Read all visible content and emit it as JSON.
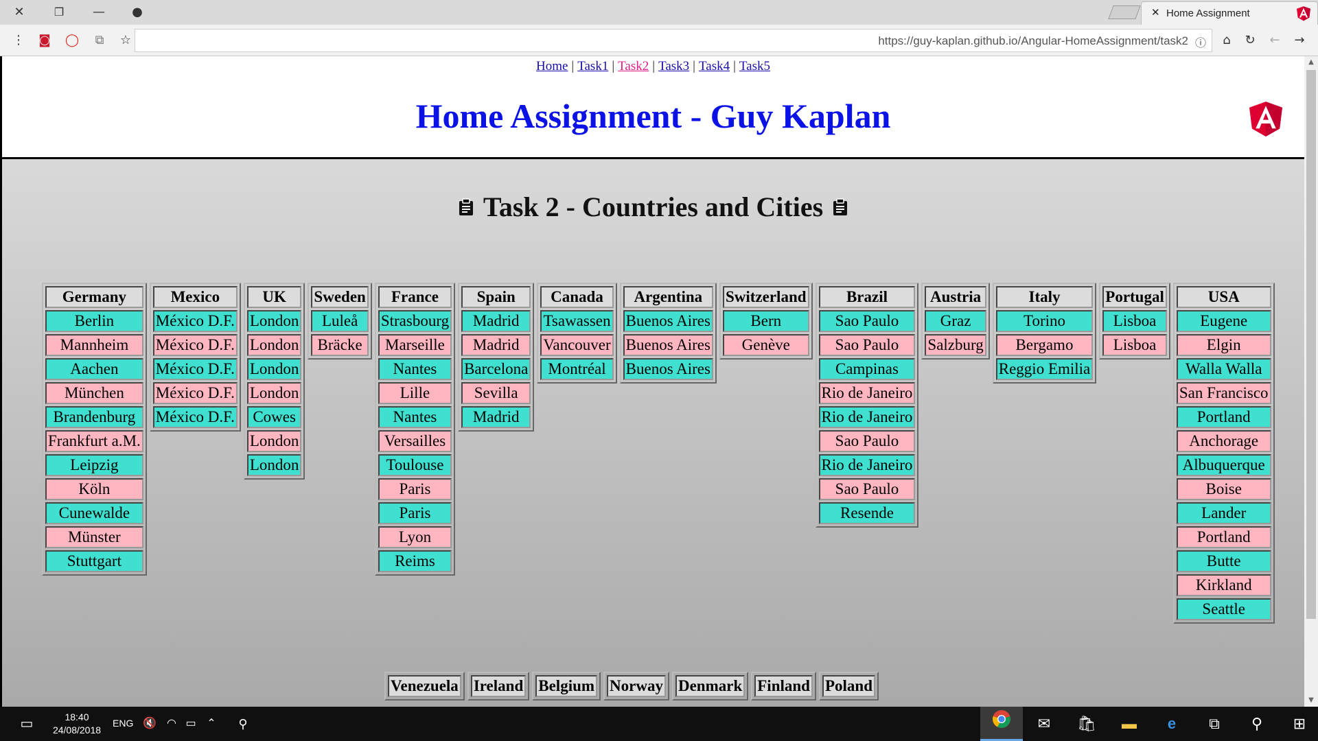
{
  "browser": {
    "tab_title": "Home Assignment",
    "url": "https://guy-kaplan.github.io/Angular-HomeAssignment/task2"
  },
  "nav": {
    "links": [
      {
        "label": "Home"
      },
      {
        "label": "Task1"
      },
      {
        "label": "Task2",
        "active": true
      },
      {
        "label": "Task3"
      },
      {
        "label": "Task4"
      },
      {
        "label": "Task5"
      }
    ],
    "separator": "|"
  },
  "header": {
    "title": "Home Assignment - Guy Kaplan"
  },
  "page": {
    "task_title": "Task 2 - Countries and Cities"
  },
  "colors": {
    "even_row": "#40e0d0",
    "odd_row": "#ffb6c1",
    "title": "#0b12e6",
    "active_link": "#e01c8c"
  },
  "countries_row1": [
    {
      "name": "Germany",
      "cities": [
        "Berlin",
        "Mannheim",
        "Aachen",
        "München",
        "Brandenburg",
        "Frankfurt a.M.",
        "Leipzig",
        "Köln",
        "Cunewalde",
        "Münster",
        "Stuttgart"
      ]
    },
    {
      "name": "Mexico",
      "cities": [
        "México D.F.",
        "México D.F.",
        "México D.F.",
        "México D.F.",
        "México D.F."
      ]
    },
    {
      "name": "UK",
      "cities": [
        "London",
        "London",
        "London",
        "London",
        "Cowes",
        "London",
        "London"
      ]
    },
    {
      "name": "Sweden",
      "cities": [
        "Luleå",
        "Bräcke"
      ]
    },
    {
      "name": "France",
      "cities": [
        "Strasbourg",
        "Marseille",
        "Nantes",
        "Lille",
        "Nantes",
        "Versailles",
        "Toulouse",
        "Paris",
        "Paris",
        "Lyon",
        "Reims"
      ]
    },
    {
      "name": "Spain",
      "cities": [
        "Madrid",
        "Madrid",
        "Barcelona",
        "Sevilla",
        "Madrid"
      ]
    },
    {
      "name": "Canada",
      "cities": [
        "Tsawassen",
        "Vancouver",
        "Montréal"
      ]
    },
    {
      "name": "Argentina",
      "cities": [
        "Buenos Aires",
        "Buenos Aires",
        "Buenos Aires"
      ]
    },
    {
      "name": "Switzerland",
      "cities": [
        "Bern",
        "Genève"
      ]
    },
    {
      "name": "Brazil",
      "cities": [
        "Sao Paulo",
        "Sao Paulo",
        "Campinas",
        "Rio de Janeiro",
        "Rio de Janeiro",
        "Sao Paulo",
        "Rio de Janeiro",
        "Sao Paulo",
        "Resende"
      ]
    },
    {
      "name": "Austria",
      "cities": [
        "Graz",
        "Salzburg"
      ]
    },
    {
      "name": "Italy",
      "cities": [
        "Torino",
        "Bergamo",
        "Reggio Emilia"
      ]
    },
    {
      "name": "Portugal",
      "cities": [
        "Lisboa",
        "Lisboa"
      ]
    },
    {
      "name": "USA",
      "cities": [
        "Eugene",
        "Elgin",
        "Walla Walla",
        "San Francisco",
        "Portland",
        "Anchorage",
        "Albuquerque",
        "Boise",
        "Lander",
        "Portland",
        "Butte",
        "Kirkland",
        "Seattle"
      ]
    }
  ],
  "countries_row2": [
    {
      "name": "Venezuela",
      "cities": []
    },
    {
      "name": "Ireland",
      "cities": []
    },
    {
      "name": "Belgium",
      "cities": []
    },
    {
      "name": "Norway",
      "cities": []
    },
    {
      "name": "Denmark",
      "cities": []
    },
    {
      "name": "Finland",
      "cities": []
    },
    {
      "name": "Poland",
      "cities": []
    }
  ],
  "taskbar": {
    "time": "18:40",
    "date": "24/08/2018",
    "language": "ENG"
  }
}
